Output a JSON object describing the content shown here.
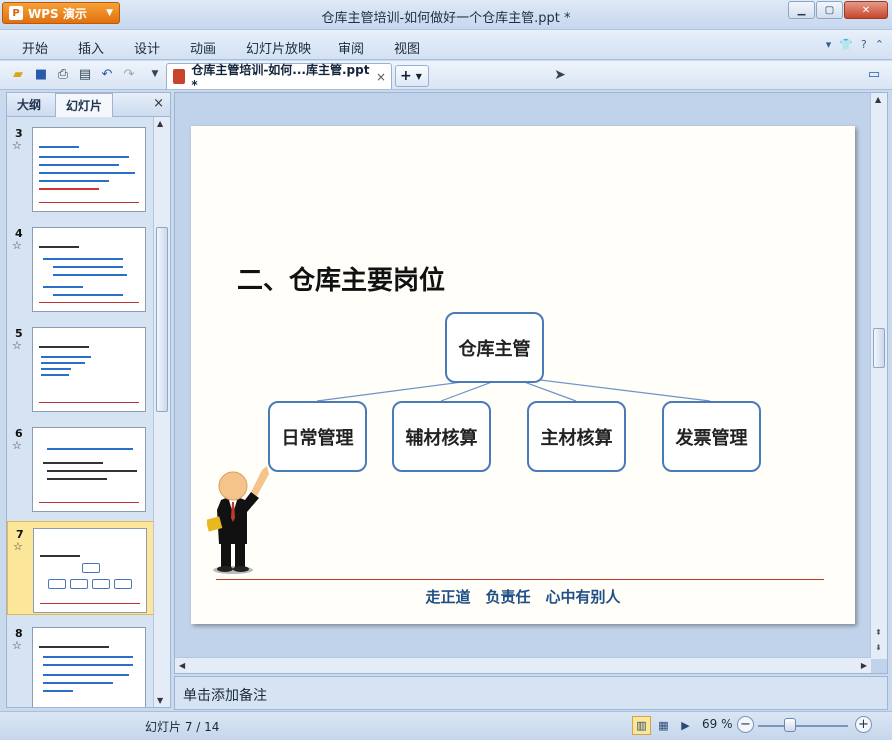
{
  "app": {
    "name": "WPS 演示",
    "logo_letter": "P"
  },
  "window": {
    "title": "仓库主管培训-如何做好一个仓库主管.ppt *"
  },
  "menu": {
    "items": [
      "开始",
      "插入",
      "设计",
      "动画",
      "幻灯片放映",
      "审阅",
      "视图"
    ]
  },
  "toolbar": {
    "doc_tab_label": "仓库主管培训-如何...库主管.ppt *",
    "close_glyph": "×",
    "new_tab_glyph": "+"
  },
  "left_panel": {
    "tabs": [
      "大纲",
      "幻灯片"
    ],
    "active_tab": "幻灯片",
    "close_glyph": "×",
    "thumbnails": [
      {
        "num": "3",
        "star": "☆"
      },
      {
        "num": "4",
        "star": "☆"
      },
      {
        "num": "5",
        "star": "☆"
      },
      {
        "num": "6",
        "star": "☆"
      },
      {
        "num": "7",
        "star": "☆",
        "selected": true
      },
      {
        "num": "8",
        "star": "☆"
      }
    ]
  },
  "slide": {
    "title": "二、仓库主要岗位",
    "root": "仓库主管",
    "children": [
      "日常管理",
      "辅材核算",
      "主材核算",
      "发票管理"
    ],
    "footer": "走正道　负责任　心中有别人"
  },
  "notes": {
    "placeholder": "单击添加备注"
  },
  "status": {
    "slide_counter": "幻灯片 7 / 14",
    "zoom": "69 %"
  },
  "colors": {
    "accent": "#e1700e",
    "node_border": "#4a7ab8",
    "footer_text": "#1f4f86",
    "footer_line": "#c0392b"
  }
}
